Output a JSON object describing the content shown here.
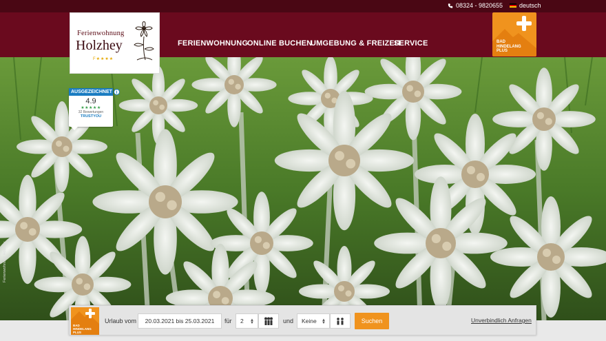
{
  "topbar": {
    "phone": "08324 - 9820655",
    "language": "deutsch"
  },
  "logo": {
    "line1": "Ferienwohnung",
    "line2": "Holzhey",
    "stars": "F★★★★"
  },
  "nav": {
    "items": [
      {
        "label": "FERIENWOHNUNG"
      },
      {
        "label": "ONLINE BUCHEN"
      },
      {
        "label": "UMGEBUNG & FREIZEIT"
      },
      {
        "label": "SERVICE"
      }
    ]
  },
  "partner_badge": {
    "text_lines": [
      "BAD",
      "HINDELANG",
      "PLUS"
    ]
  },
  "trustyou": {
    "header": "AUSGEZEICHNET",
    "score": "4.9",
    "stars": "★★★★★",
    "reviews": "32 Bewertungen",
    "brand": "TRUSTYOU"
  },
  "hero": {
    "credit": "Ferienwohnung Holzhey"
  },
  "booking": {
    "vacation_label": "Urlaub vom",
    "date_range": "20.03.2021 bis 25.03.2021",
    "for_label": "für",
    "adults_value": "2",
    "and_label": "und",
    "kids_value": "Keine",
    "search_label": "Suchen",
    "request_link": "Unverbindlich Anfragen"
  },
  "colors": {
    "topbar": "#4a0714",
    "header": "#6a0a1e",
    "accent_orange": "#f0931e",
    "trustyou_blue": "#1a7cc1"
  }
}
